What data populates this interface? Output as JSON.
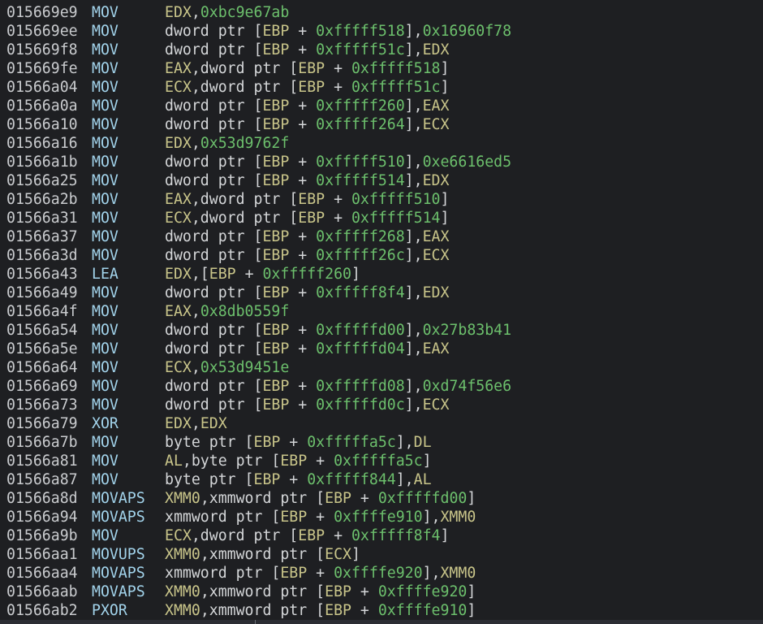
{
  "colors": {
    "background": "#1e1f22",
    "address": "#c9cbce",
    "mnemonic": "#a3d4ec",
    "register": "#c9c58a",
    "hex": "#6cbf6c",
    "text": "#d4d6d8"
  },
  "listing": [
    {
      "address": "015669e9",
      "mnemonic": "MOV",
      "operands": "EDX,0xbc9e67ab"
    },
    {
      "address": "015669ee",
      "mnemonic": "MOV",
      "operands": "dword ptr [EBP + 0xfffff518],0x16960f78"
    },
    {
      "address": "015669f8",
      "mnemonic": "MOV",
      "operands": "dword ptr [EBP + 0xfffff51c],EDX"
    },
    {
      "address": "015669fe",
      "mnemonic": "MOV",
      "operands": "EAX,dword ptr [EBP + 0xfffff518]"
    },
    {
      "address": "01566a04",
      "mnemonic": "MOV",
      "operands": "ECX,dword ptr [EBP + 0xfffff51c]"
    },
    {
      "address": "01566a0a",
      "mnemonic": "MOV",
      "operands": "dword ptr [EBP + 0xfffff260],EAX"
    },
    {
      "address": "01566a10",
      "mnemonic": "MOV",
      "operands": "dword ptr [EBP + 0xfffff264],ECX"
    },
    {
      "address": "01566a16",
      "mnemonic": "MOV",
      "operands": "EDX,0x53d9762f"
    },
    {
      "address": "01566a1b",
      "mnemonic": "MOV",
      "operands": "dword ptr [EBP + 0xfffff510],0xe6616ed5"
    },
    {
      "address": "01566a25",
      "mnemonic": "MOV",
      "operands": "dword ptr [EBP + 0xfffff514],EDX"
    },
    {
      "address": "01566a2b",
      "mnemonic": "MOV",
      "operands": "EAX,dword ptr [EBP + 0xfffff510]"
    },
    {
      "address": "01566a31",
      "mnemonic": "MOV",
      "operands": "ECX,dword ptr [EBP + 0xfffff514]"
    },
    {
      "address": "01566a37",
      "mnemonic": "MOV",
      "operands": "dword ptr [EBP + 0xfffff268],EAX"
    },
    {
      "address": "01566a3d",
      "mnemonic": "MOV",
      "operands": "dword ptr [EBP + 0xfffff26c],ECX"
    },
    {
      "address": "01566a43",
      "mnemonic": "LEA",
      "operands": "EDX,[EBP + 0xfffff260]"
    },
    {
      "address": "01566a49",
      "mnemonic": "MOV",
      "operands": "dword ptr [EBP + 0xfffff8f4],EDX"
    },
    {
      "address": "01566a4f",
      "mnemonic": "MOV",
      "operands": "EAX,0x8db0559f"
    },
    {
      "address": "01566a54",
      "mnemonic": "MOV",
      "operands": "dword ptr [EBP + 0xfffffd00],0x27b83b41"
    },
    {
      "address": "01566a5e",
      "mnemonic": "MOV",
      "operands": "dword ptr [EBP + 0xfffffd04],EAX"
    },
    {
      "address": "01566a64",
      "mnemonic": "MOV",
      "operands": "ECX,0x53d9451e"
    },
    {
      "address": "01566a69",
      "mnemonic": "MOV",
      "operands": "dword ptr [EBP + 0xfffffd08],0xd74f56e6"
    },
    {
      "address": "01566a73",
      "mnemonic": "MOV",
      "operands": "dword ptr [EBP + 0xfffffd0c],ECX"
    },
    {
      "address": "01566a79",
      "mnemonic": "XOR",
      "operands": "EDX,EDX"
    },
    {
      "address": "01566a7b",
      "mnemonic": "MOV",
      "operands": "byte ptr [EBP + 0xfffffa5c],DL"
    },
    {
      "address": "01566a81",
      "mnemonic": "MOV",
      "operands": "AL,byte ptr [EBP + 0xfffffa5c]"
    },
    {
      "address": "01566a87",
      "mnemonic": "MOV",
      "operands": "byte ptr [EBP + 0xfffff844],AL"
    },
    {
      "address": "01566a8d",
      "mnemonic": "MOVAPS",
      "operands": "XMM0,xmmword ptr [EBP + 0xfffffd00]"
    },
    {
      "address": "01566a94",
      "mnemonic": "MOVAPS",
      "operands": "xmmword ptr [EBP + 0xffffe910],XMM0"
    },
    {
      "address": "01566a9b",
      "mnemonic": "MOV",
      "operands": "ECX,dword ptr [EBP + 0xfffff8f4]"
    },
    {
      "address": "01566aa1",
      "mnemonic": "MOVUPS",
      "operands": "XMM0,xmmword ptr [ECX]"
    },
    {
      "address": "01566aa4",
      "mnemonic": "MOVAPS",
      "operands": "xmmword ptr [EBP + 0xffffe920],XMM0"
    },
    {
      "address": "01566aab",
      "mnemonic": "MOVAPS",
      "operands": "XMM0,xmmword ptr [EBP + 0xffffe920]"
    },
    {
      "address": "01566ab2",
      "mnemonic": "PXOR",
      "operands": "XMM0,xmmword ptr [EBP + 0xffffe910]"
    }
  ]
}
